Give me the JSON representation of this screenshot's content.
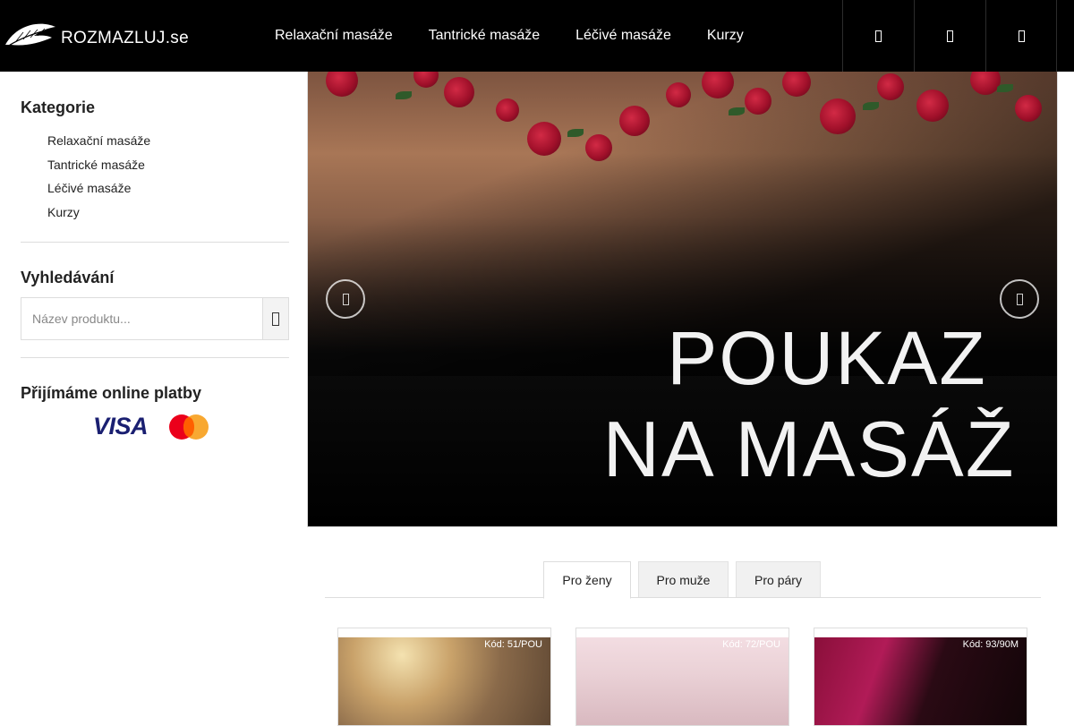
{
  "header": {
    "logo_text": "ROZMAZLUJ.se",
    "nav": [
      {
        "label": "Relaxační masáže"
      },
      {
        "label": "Tantrické masáže"
      },
      {
        "label": "Léčivé masáže"
      },
      {
        "label": "Kurzy"
      }
    ],
    "icons": [
      "user-icon",
      "search-icon",
      "cart-icon"
    ]
  },
  "sidebar": {
    "categories_title": "Kategorie",
    "categories": [
      {
        "label": "Relaxační masáže"
      },
      {
        "label": "Tantrické masáže"
      },
      {
        "label": "Léčivé masáže"
      },
      {
        "label": "Kurzy"
      }
    ],
    "search_title": "Vyhledávání",
    "search_placeholder": "Název produktu...",
    "payments_title": "Přijímáme online platby",
    "payment_logos": [
      {
        "label": "VISA"
      },
      {
        "label": "Mastercard"
      }
    ]
  },
  "banner": {
    "line1": "POUKAZ",
    "line2": "NA MASÁŽ"
  },
  "tabs": [
    {
      "label": "Pro ženy",
      "active": true
    },
    {
      "label": "Pro muže",
      "active": false
    },
    {
      "label": "Pro páry",
      "active": false
    }
  ],
  "products": [
    {
      "code": "Kód: 51/POU"
    },
    {
      "code": "Kód: 72/POU"
    },
    {
      "code": "Kód: 93/90M"
    }
  ],
  "colors": {
    "header_bg": "#000000",
    "tab_inactive_bg": "#f1f1f1"
  }
}
